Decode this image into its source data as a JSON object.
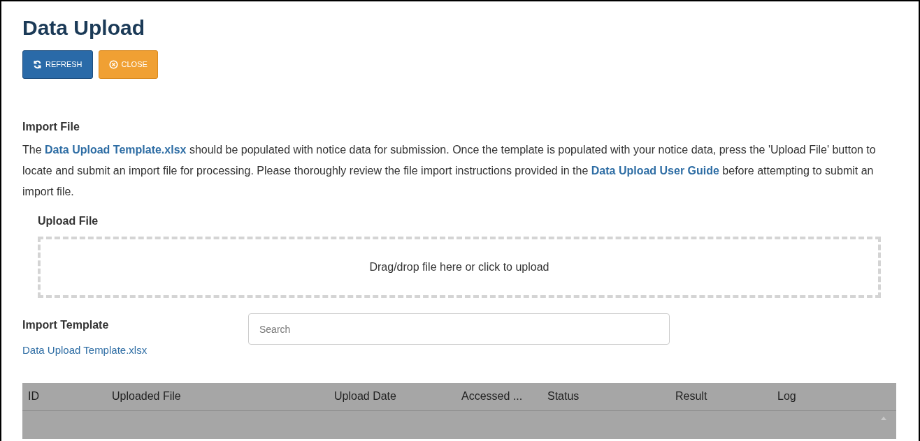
{
  "title": "Data Upload",
  "buttons": [
    {
      "kind": "refresh",
      "label": "REFRESH"
    },
    {
      "kind": "close",
      "label": "CLOSE"
    }
  ],
  "import_file": {
    "heading": "Import File",
    "paragraph": [
      {
        "text": "The ",
        "link": false
      },
      {
        "text": "Data Upload Template.xlsx",
        "link": true
      },
      {
        "text": " should be populated with notice data for submission. Once the template is populated with your notice data, press the 'Upload File' button to locate and submit an import file for processing. Please thoroughly review the file import instructions provided in the ",
        "link": false
      },
      {
        "text": "Data Upload User Guide",
        "link": true
      },
      {
        "text": " before attempting to submit an import file.",
        "link": false
      }
    ]
  },
  "upload_file": {
    "heading": "Upload File",
    "dropzone": "Drag/drop file here or click to upload"
  },
  "import_template": {
    "heading": "Import Template",
    "link": "Data Upload Template.xlsx"
  },
  "search": {
    "placeholder": "Search"
  },
  "table": {
    "columns": [
      "ID",
      "Uploaded File",
      "Upload Date",
      "Accessed ...",
      "Status",
      "Result",
      "Log"
    ]
  }
}
